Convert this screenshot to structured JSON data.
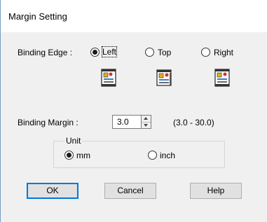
{
  "window": {
    "title": "Margin Setting"
  },
  "binding_edge": {
    "label": "Binding Edge :",
    "options": [
      {
        "label": "Left",
        "checked": true
      },
      {
        "label": "Top",
        "checked": false
      },
      {
        "label": "Right",
        "checked": false
      }
    ]
  },
  "binding_margin": {
    "label": "Binding Margin :",
    "value": "3.0",
    "range": "(3.0 - 30.0)"
  },
  "unit": {
    "label": "Unit",
    "options": [
      {
        "label": "mm",
        "checked": true
      },
      {
        "label": "inch",
        "checked": false
      }
    ]
  },
  "buttons": {
    "ok": "OK",
    "cancel": "Cancel",
    "help": "Help"
  },
  "colors": {
    "default_button_border": "#0078d7",
    "dialog_bg": "#f0f0f0"
  }
}
